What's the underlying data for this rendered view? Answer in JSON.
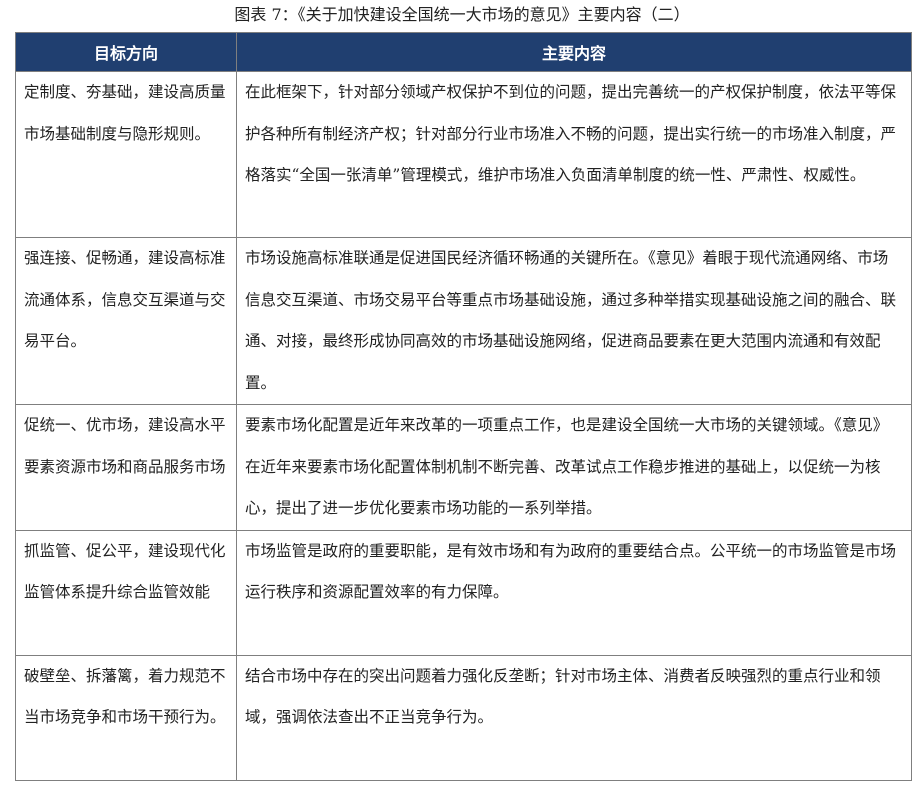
{
  "caption": "图表 7：《关于加快建设全国统一大市场的意见》主要内容（二）",
  "table": {
    "headers": [
      "目标方向",
      "主要内容"
    ],
    "rows": [
      {
        "direction": "定制度、夯基础，建设高质量市场基础制度与隐形规则。",
        "content": "在此框架下，针对部分领域产权保护不到位的问题，提出完善统一的产权保护制度，依法平等保护各种所有制经济产权；针对部分行业市场准入不畅的问题，提出实行统一的市场准入制度，严格落实“全国一张清单”管理模式，维护市场准入负面清单制度的统一性、严肃性、权威性。"
      },
      {
        "direction": "强连接、促畅通，建设高标准流通体系，信息交互渠道与交易平台。",
        "content": "市场设施高标准联通是促进国民经济循环畅通的关键所在。《意见》着眼于现代流通网络、市场信息交互渠道、市场交易平台等重点市场基础设施，通过多种举措实现基础设施之间的融合、联通、对接，最终形成协同高效的市场基础设施网络，促进商品要素在更大范围内流通和有效配置。"
      },
      {
        "direction": "促统一、优市场，建设高水平要素资源市场和商品服务市场",
        "content": "要素市场化配置是近年来改革的一项重点工作，也是建设全国统一大市场的关键领域。《意见》在近年来要素市场化配置体制机制不断完善、改革试点工作稳步推进的基础上，以促统一为核心，提出了进一步优化要素市场功能的一系列举措。"
      },
      {
        "direction": "抓监管、促公平，建设现代化监管体系提升综合监管效能",
        "content": "市场监管是政府的重要职能，是有效市场和有为政府的重要结合点。公平统一的市场监管是市场运行秩序和资源配置效率的有力保障。"
      },
      {
        "direction": "破壁垒、拆藩篱，着力规范不当市场竞争和市场干预行为。",
        "content": "结合市场中存在的突出问题着力强化反垄断；针对市场主体、消费者反映强烈的重点行业和领域，强调依法查出不正当竞争行为。"
      }
    ]
  },
  "colors": {
    "header_background": "#203f70",
    "header_text": "#ffffff",
    "border": "#7f7f7f",
    "body_text": "#222222"
  }
}
